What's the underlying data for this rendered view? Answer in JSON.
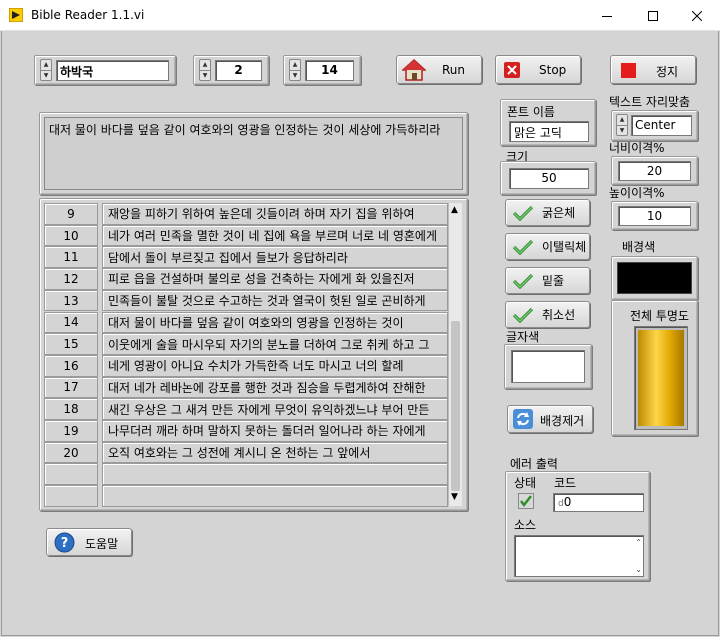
{
  "window": {
    "title": "Bible Reader 1.1.vi",
    "minimize_icon": "minimize-icon",
    "maximize_icon": "maximize-icon",
    "close_icon": "close-icon"
  },
  "selectors": {
    "book": "하박국",
    "chapter": "2",
    "verse": "14"
  },
  "buttons": {
    "run": "Run",
    "stop": "Stop",
    "halt": "정지",
    "help": "도움말",
    "remove_bg": "배경제거"
  },
  "verse_display": "대저 물이 바다를 덮음 같이 여호와의 영광을 인정하는 것이 세상에 가득하리라",
  "verse_table": {
    "rows": [
      {
        "num": "9",
        "text": "재앙을 피하기 위하여 높은데 깃들이려 하며 자기 집을 위하여"
      },
      {
        "num": "10",
        "text": "네가 여러 민족을 멸한 것이 네 집에 욕을 부르며 너로 네 영혼에게"
      },
      {
        "num": "11",
        "text": "담에서 돌이 부르짖고 집에서 들보가 응답하리라"
      },
      {
        "num": "12",
        "text": "피로 읍을 건설하며 불의로 성을 건축하는 자에게 화 있을진저"
      },
      {
        "num": "13",
        "text": "민족들이 불탈 것으로 수고하는 것과 열국이 헛된 일로 곤비하게"
      },
      {
        "num": "14",
        "text": "대저 물이 바다를 덮음 같이 여호와의 영광을 인정하는 것이"
      },
      {
        "num": "15",
        "text": "이웃에게 술을 마시우되 자기의 분노를 더하여 그로 취케 하고 그"
      },
      {
        "num": "16",
        "text": "네게 영광이 아니요 수치가 가득한즉 너도 마시고 너의 할례"
      },
      {
        "num": "17",
        "text": "대저 네가 레바논에 강포를 행한 것과 짐승을 두렵게하여 잔해한"
      },
      {
        "num": "18",
        "text": "새긴 우상은 그 새겨 만든 자에게 무엇이 유익하겠느냐 부어 만든"
      },
      {
        "num": "19",
        "text": "나무더러 깨라 하며 말하지 못하는 돌더러 일어나라 하는 자에게"
      },
      {
        "num": "20",
        "text": "오직 여호와는 그 성전에 계시니 온 천하는 그 앞에서"
      }
    ]
  },
  "font_panel": {
    "font_name_label": "폰트 이름",
    "font_name_value": "맑은 고딕",
    "size_label": "크기",
    "size_value": "50",
    "bold": "굵은체",
    "italic": "이탤릭체",
    "underline": "밑줄",
    "strikeout": "취소선",
    "text_color_label": "글자색"
  },
  "right_panel": {
    "align_label": "텍스트 자리맞춤",
    "align_value": "Center",
    "width_label": "너비이격%",
    "width_value": "20",
    "height_label": "높이이격%",
    "height_value": "10",
    "bg_color_label": "배경색",
    "bg_color": "#000000",
    "transparency_label": "전체 투명도",
    "transparency_level": 1.0
  },
  "error_out": {
    "title": "에러 출력",
    "status_label": "상태",
    "code_label": "코드",
    "code_value": "0",
    "source_label": "소스",
    "source_value": ""
  },
  "colors": {
    "accent_gold": "#e6b800",
    "stop_red": "#e51c1c",
    "check_green": "#2f8f2f"
  }
}
